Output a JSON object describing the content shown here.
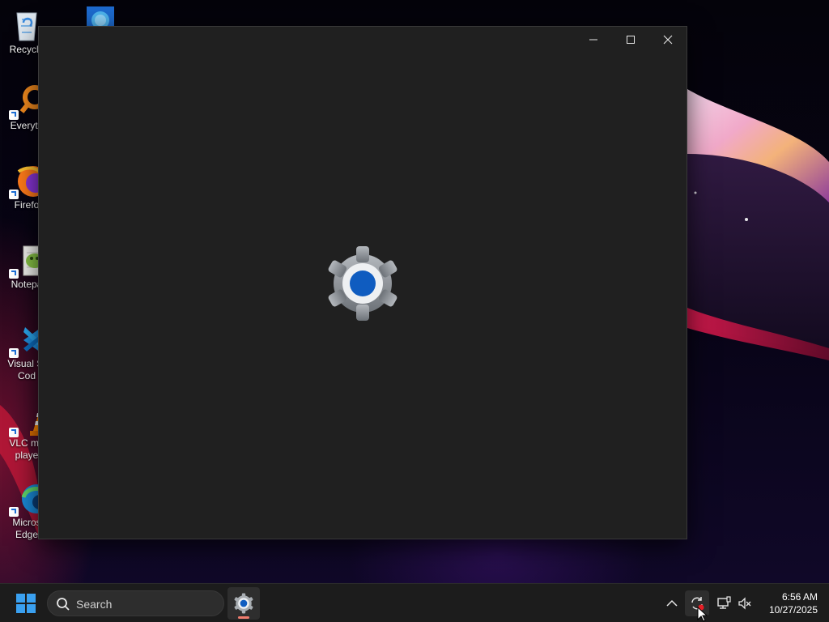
{
  "desktop": {
    "icons": [
      {
        "label": "Recycle",
        "icon": "recycle-bin-icon"
      },
      {
        "label": "Everyth",
        "icon": "everything-search-icon"
      },
      {
        "label": "Firefo",
        "icon": "firefox-icon"
      },
      {
        "label": "Notepa",
        "icon": "notepad-plus-plus-icon"
      },
      {
        "label": "Visual St\nCod",
        "icon": "vscode-icon"
      },
      {
        "label": "VLC me\nplaye",
        "icon": "vlc-icon"
      },
      {
        "label": "Micros\nEdge",
        "icon": "edge-icon"
      }
    ]
  },
  "window": {
    "app": "Settings",
    "splash_icon": "settings-gear-icon",
    "controls": [
      "minimize-icon",
      "maximize-icon",
      "close-icon"
    ]
  },
  "taskbar": {
    "start_icon": "windows-logo-icon",
    "search_placeholder": "Search",
    "pinned_app_icon": "settings-gear-icon",
    "tray_icons": [
      "chevron-up-icon",
      "sync-icon",
      "network-icon",
      "volume-muted-icon"
    ],
    "time": "6:56 AM",
    "date": "10/27/2025"
  },
  "colors": {
    "accent": "#0f5cc0",
    "window_bg": "#202020",
    "taskbar_bg": "#1c1c1c",
    "app_indicator": "#f07c6e"
  }
}
